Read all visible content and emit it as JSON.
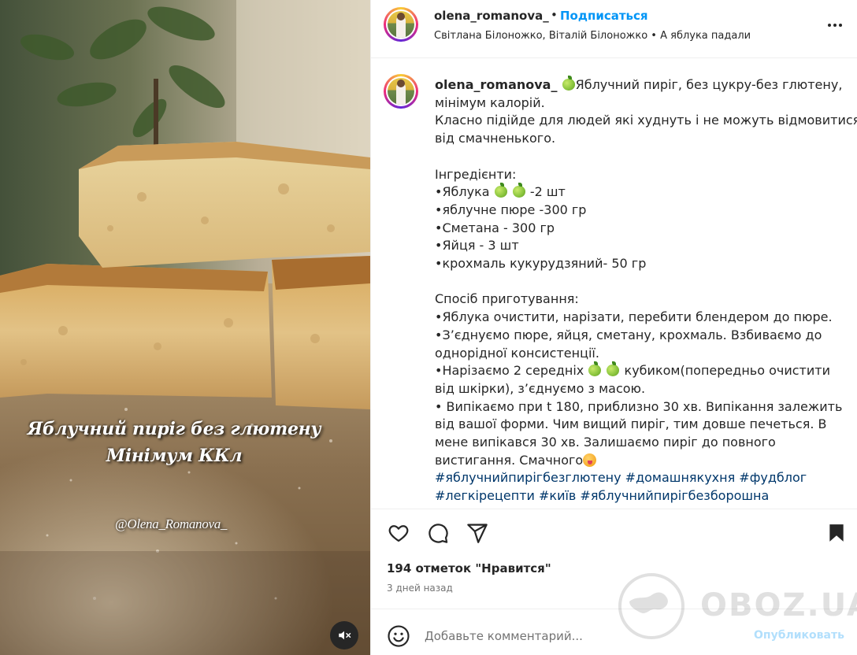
{
  "media": {
    "overlay_line1": "Яблучний пиріг без глютену",
    "overlay_line2": "Мінімум ККл",
    "overlay_handle": "@Olena_Romanova_",
    "mute_icon": "speaker-muted-icon"
  },
  "header": {
    "username": "olena_romanova_",
    "separator": "•",
    "follow_label": "Подписаться",
    "audio_info": "Світлана Білоножко, Віталій Білоножко • А яблука падали",
    "more_icon": "more-options-icon"
  },
  "caption": {
    "username": "olena_romanova_",
    "title_text": "Яблучний пиріг, без цукру-без глютену,",
    "lines": [
      "мінімум калорій.",
      "Класно підійде для людей які худнуть і не можуть відмовитися",
      "від смачненького.",
      "",
      "Інгредієнти:"
    ],
    "ingredient_apples_prefix": "•Яблука",
    "ingredient_apples_suffix": "-2 шт",
    "ingredients": [
      "•яблучне пюре -300 гр",
      "•Сметана - 300 гр",
      "•Яйця - 3 шт",
      "•крохмаль кукурудзяний- 50 гр"
    ],
    "method_title": "Спосіб приготування:",
    "method_lines_a": [
      "•Яблука очистити, нарізати, перебити блендером до пюре.",
      "•З’єднуємо пюре, яйця, сметану, крохмаль. Взбиваємо до",
      "однорідної консистенції."
    ],
    "method_cut_prefix": "•Нарізаємо 2 середніх",
    "method_cut_suffix": "кубиком(попередньо очистити",
    "method_lines_b": [
      "від шкірки), з’єднуємо з масою.",
      "• Випікаємо при t 180, приблизно 30 хв. Випікання залежить",
      "від вашої форми. Чим вищий пиріг, тим довше печеться. В",
      "мене випікався 30 хв. Залишаємо пиріг до повного"
    ],
    "method_end_text": "вистигання. Смачного",
    "hashtags_line1": "#яблучнийпирігбезглютену #домашнякухня #фудблог",
    "hashtags_line2": "#легкірецепти #київ #яблучнийпирігбезборошна"
  },
  "actions": {
    "like_icon": "heart-icon",
    "comment_icon": "comment-icon",
    "share_icon": "share-icon",
    "save_icon": "bookmark-icon"
  },
  "stats": {
    "likes_text": "194 отметок \"Нравится\"",
    "time_ago": "3 дней назад"
  },
  "comment": {
    "emoji_icon": "emoji-icon",
    "placeholder": "Добавьте комментарий...",
    "post_label": "Опубликовать"
  },
  "watermark": {
    "text": "OBOZ.UA"
  },
  "colors": {
    "link_blue": "#0095f6",
    "hashtag_blue": "#00376b",
    "text": "#262626",
    "muted": "#737373"
  }
}
